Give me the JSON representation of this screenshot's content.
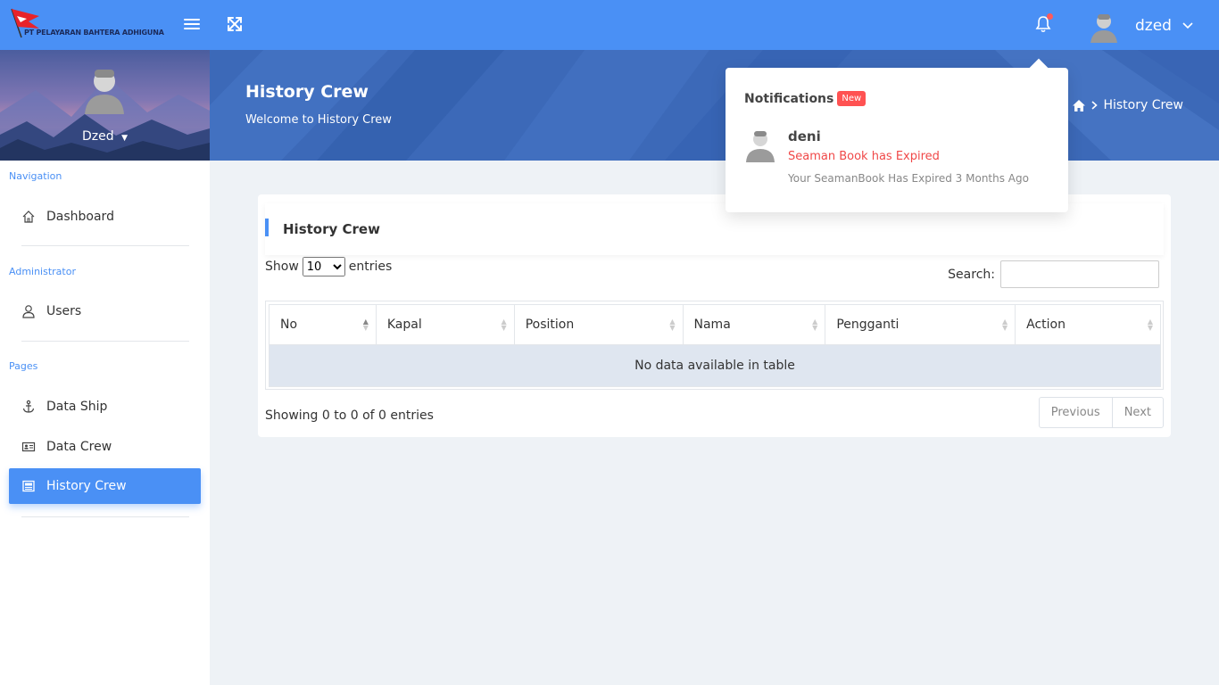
{
  "topbar": {
    "company_name": "PT PELAYARAN BAHTERA ADHIGUNA",
    "user_name": "dzed"
  },
  "sidebar": {
    "profile_name": "Dzed",
    "sections": {
      "navigation": "Navigation",
      "administrator": "Administrator",
      "pages": "Pages"
    },
    "items": {
      "dashboard": "Dashboard",
      "users": "Users",
      "data_ship": "Data Ship",
      "data_crew": "Data Crew",
      "history_crew": "History Crew"
    }
  },
  "banner": {
    "title": "History Crew",
    "subtitle": "Welcome to History Crew",
    "breadcrumb_current": "History Crew"
  },
  "card": {
    "title": "History Crew",
    "show_label": "Show",
    "entries_label": "entries",
    "page_size": "10",
    "search_label": "Search:",
    "columns": [
      "No",
      "Kapal",
      "Position",
      "Nama",
      "Pengganti",
      "Action"
    ],
    "empty_message": "No data available in table",
    "info": "Showing 0 to 0 of 0 entries",
    "previous": "Previous",
    "next": "Next"
  },
  "notifications": {
    "title": "Notifications",
    "badge": "New",
    "items": [
      {
        "user": "deni",
        "message": "Seaman Book has Expired",
        "detail": "Your SeamanBook Has Expired 3 Months Ago"
      }
    ]
  },
  "colors": {
    "primary": "#4a90f5",
    "banner": "#3c69b8",
    "danger": "#ff5252"
  }
}
